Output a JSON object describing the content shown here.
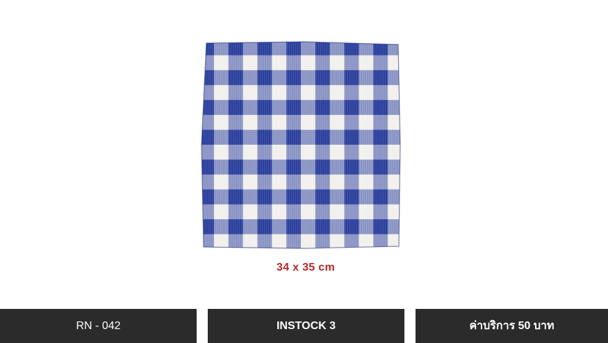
{
  "product": {
    "image": {
      "kind": "blue-white-gingham-cloth-napkin",
      "colors": {
        "blue": "#2a3f9c",
        "mid": "#8a94c4",
        "white": "#f2f0ec"
      }
    },
    "dimensions": "34 x 35 cm"
  },
  "bars": {
    "code": "RN - 042",
    "stock": "INSTOCK 3",
    "price": "ค่าบริการ 50 บาท"
  },
  "colors": {
    "bar_background": "#2b2b2b",
    "bar_text": "#ffffff",
    "dimension_text": "#b5272d"
  }
}
